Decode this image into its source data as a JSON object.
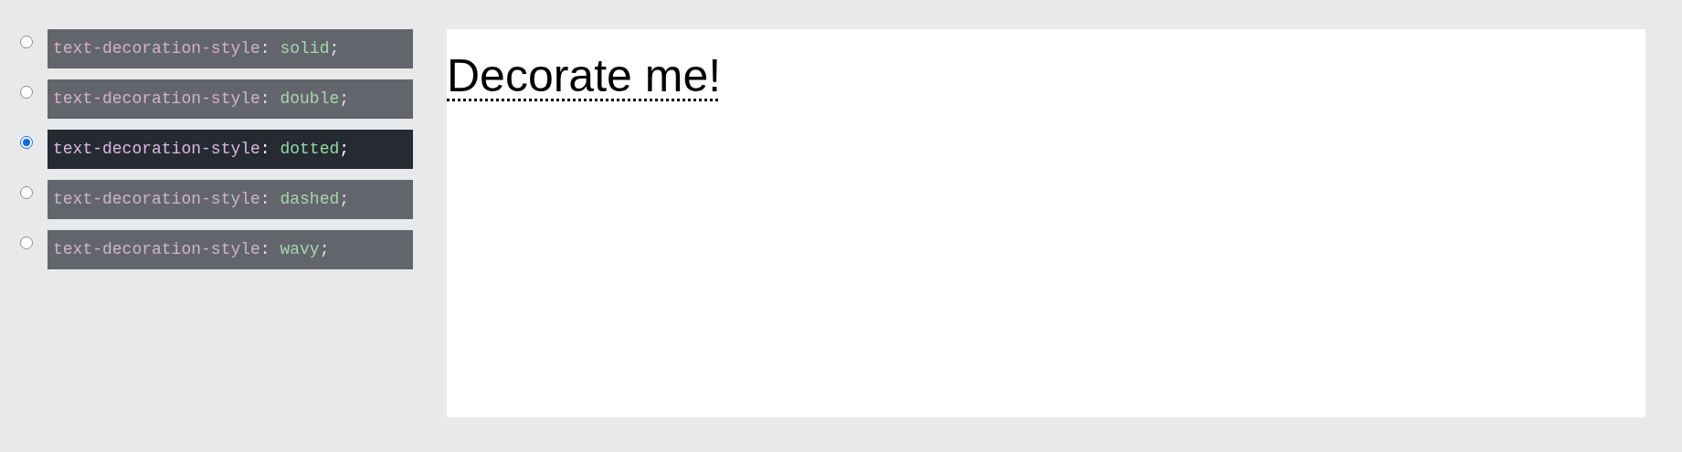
{
  "options": [
    {
      "property": "text-decoration-style",
      "colon": ":",
      "value": "solid",
      "end": ";",
      "selected": false
    },
    {
      "property": "text-decoration-style",
      "colon": ":",
      "value": "double",
      "end": ";",
      "selected": false
    },
    {
      "property": "text-decoration-style",
      "colon": ":",
      "value": "dotted",
      "end": ";",
      "selected": true
    },
    {
      "property": "text-decoration-style",
      "colon": ":",
      "value": "dashed",
      "end": ";",
      "selected": false
    },
    {
      "property": "text-decoration-style",
      "colon": ":",
      "value": "wavy",
      "end": ";",
      "selected": false
    }
  ],
  "output": {
    "text": "Decorate me!",
    "kind": "dotted"
  }
}
